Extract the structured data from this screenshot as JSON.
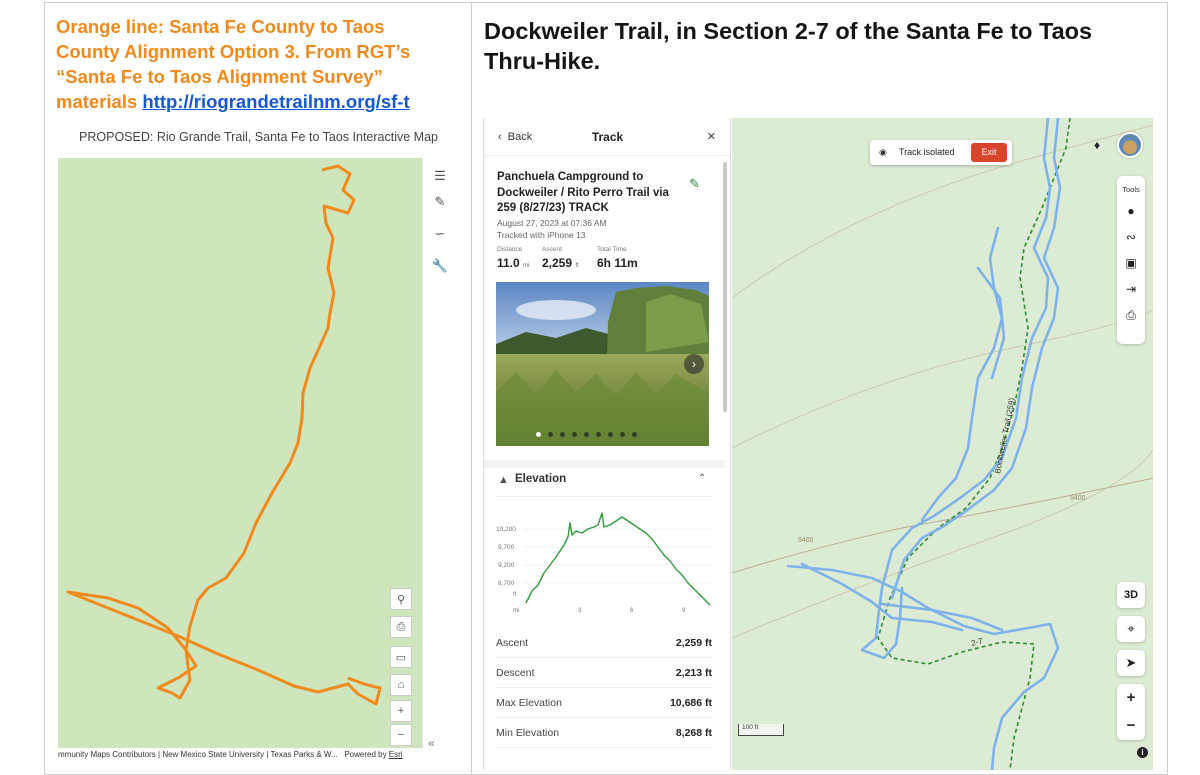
{
  "left": {
    "caption": {
      "line1": "Orange line: Santa Fe County to Taos",
      "line2": "County Alignment Option 3. From RGT’s",
      "line3": "“Santa Fe to Taos Alignment Survey”",
      "line4_prefix": "materials ",
      "link": "http://riograndetrailnm.org/sf-t"
    },
    "map_title": "PROPOSED: Rio Grande Trail, Santa Fe to Taos Interactive Map",
    "attribution": "mmunity Maps Contributors | New Mexico State University | Texas Parks & W...",
    "powered_by": "Powered by ",
    "esri": "Esri",
    "colors": {
      "map_bg": "#cfe6bd",
      "route": "#f08a1c"
    },
    "toolbar_icons": [
      "sliders-icon",
      "layers-edit-icon",
      "draw-icon",
      "wrench-icon"
    ],
    "map_controls": [
      "search-icon",
      "print-icon",
      "monitor-icon",
      "home-icon",
      "zoom-in-icon",
      "zoom-out-icon"
    ],
    "collapse": "«"
  },
  "right": {
    "heading_line1": "Dockweiler Trail, in Section 2-7 of the Santa Fe to Taos",
    "heading_line2": "Thru-Hike.",
    "panel": {
      "back": "Back",
      "title": "Track",
      "close": "×",
      "track_title_line1": "Panchuela Campground to",
      "track_title_line2": "Dockweiler / Rito Perro Trail via",
      "track_title_line3": "259 (8/27/23) TRACK",
      "date": "August 27, 2023 at 07:36 AM",
      "device": "Tracked with iPhone 13",
      "stats": {
        "distance_label": "Distance",
        "distance_value": "11.0",
        "distance_unit": "mi",
        "ascent_label": "Ascent",
        "ascent_value": "2,259",
        "ascent_unit": "ft",
        "time_label": "Total Time",
        "time_value": "6h 11m"
      },
      "photo_count": 9,
      "photo_active": 1,
      "elevation_title": "Elevation",
      "profile": {
        "y_ticks": [
          "10,200",
          "9,700",
          "9,200",
          "8,700"
        ],
        "y_unit": "ft",
        "x_unit": "mi",
        "x_ticks": [
          "3",
          "6",
          "9"
        ]
      },
      "rows": [
        {
          "label": "Ascent",
          "value": "2,259 ft"
        },
        {
          "label": "Descent",
          "value": "2,213 ft"
        },
        {
          "label": "Max Elevation",
          "value": "10,686 ft"
        },
        {
          "label": "Min Elevation",
          "value": "8,268 ft"
        }
      ]
    },
    "map": {
      "isolated_text": "Track isolated",
      "exit": "Exit",
      "tools_label": "Tools",
      "tool_icons": [
        "pin-icon",
        "route-icon",
        "crop-icon",
        "import-icon",
        "print-icon"
      ],
      "btn_3d": "3D",
      "scale": "100 ft",
      "contour_labels": [
        "9400",
        "9400"
      ],
      "trail_label": "Bockweiler Trail (259)",
      "route_label": "2-7",
      "colors": {
        "map_bg": "#dcecd4",
        "track": "#7fb2ea",
        "trail": "#2e8b2e",
        "exit": "#d9442a"
      }
    }
  }
}
